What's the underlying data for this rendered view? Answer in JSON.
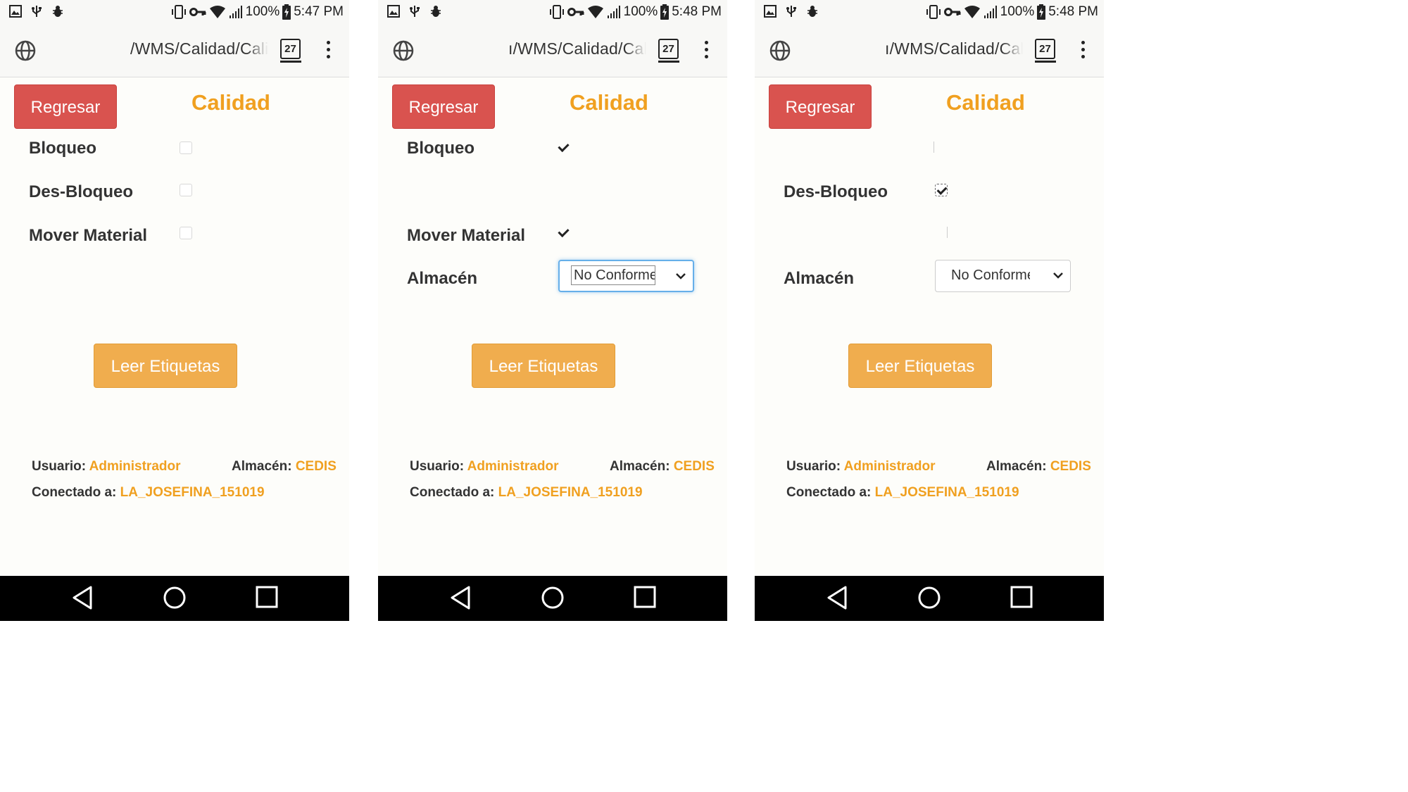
{
  "screens": [
    {
      "status": {
        "battery": "100%",
        "time": "5:47 PM"
      },
      "browser": {
        "url": "/WMS/Calidad/Calic",
        "tab_count": "27"
      },
      "back_button": "Regresar",
      "title": "Calidad",
      "options": [
        {
          "label": "Bloqueo",
          "checked": false
        },
        {
          "label": "Des-Bloqueo",
          "checked": false
        },
        {
          "label": "Mover Material",
          "checked": false
        }
      ],
      "read_button": "Leer Etiquetas",
      "footer": {
        "usuario_label": "Usuario:",
        "usuario": "Administrador",
        "almacen_label": "Almacén:",
        "almacen": "CEDIS",
        "conectado_label": "Conectado a:",
        "conectado": "LA_JOSEFINA_151019"
      }
    },
    {
      "status": {
        "battery": "100%",
        "time": "5:48 PM"
      },
      "browser": {
        "url": "ı/WMS/Calidad/Calic",
        "tab_count": "27"
      },
      "back_button": "Regresar",
      "title": "Calidad",
      "options": [
        {
          "label": "Bloqueo",
          "checked": true
        },
        {
          "label": "Mover Material",
          "checked": true
        }
      ],
      "almacen_field": {
        "label": "Almacén",
        "selected": "No Conforme C"
      },
      "read_button": "Leer Etiquetas",
      "footer": {
        "usuario_label": "Usuario:",
        "usuario": "Administrador",
        "almacen_label": "Almacén:",
        "almacen": "CEDIS",
        "conectado_label": "Conectado a:",
        "conectado": "LA_JOSEFINA_151019"
      }
    },
    {
      "status": {
        "battery": "100%",
        "time": "5:48 PM"
      },
      "browser": {
        "url": "ı/WMS/Calidad/Calic",
        "tab_count": "27"
      },
      "back_button": "Regresar",
      "title": "Calidad",
      "options": [
        {
          "label": "Des-Bloqueo",
          "checked": true
        }
      ],
      "almacen_field": {
        "label": "Almacén",
        "selected": "No Conforme C"
      },
      "read_button": "Leer Etiquetas",
      "footer": {
        "usuario_label": "Usuario:",
        "usuario": "Administrador",
        "almacen_label": "Almacén:",
        "almacen": "CEDIS",
        "conectado_label": "Conectado a:",
        "conectado": "LA_JOSEFINA_151019"
      }
    }
  ]
}
